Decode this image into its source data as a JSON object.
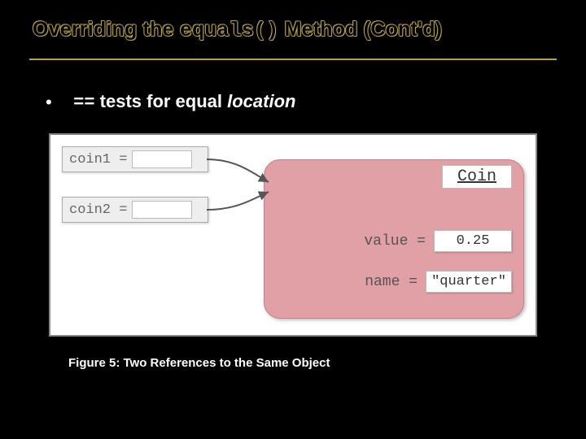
{
  "title": {
    "pre": "Overriding the ",
    "code": "equals()",
    "post": " Method (Cont'd)"
  },
  "bullet": {
    "dot": "•",
    "code": "==",
    "text_plain": "  tests for equal ",
    "text_italic": "location"
  },
  "figure": {
    "var1_label": "coin1 =",
    "var2_label": "coin2 =",
    "class_name": "Coin",
    "fields": {
      "value_label": "value  =",
      "value_value": "0.25",
      "name_label": "name  =",
      "name_value": "\"quarter\""
    }
  },
  "caption": "Figure 5: Two References to the Same Object"
}
